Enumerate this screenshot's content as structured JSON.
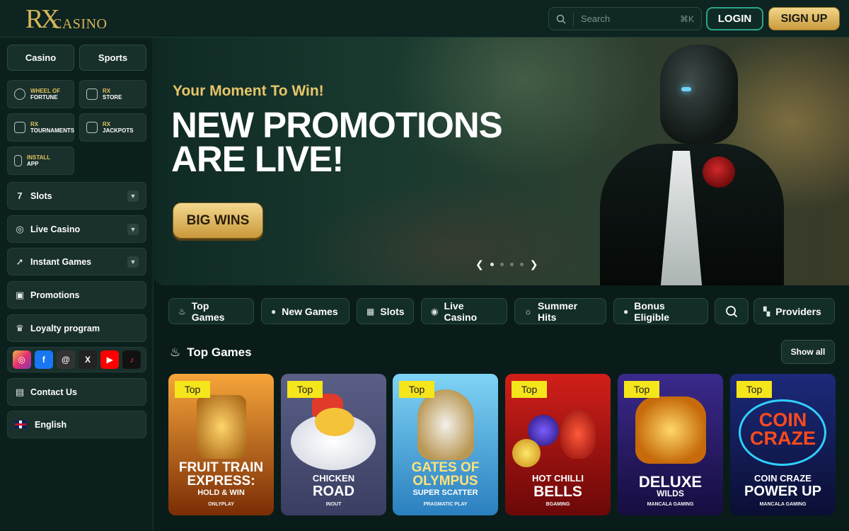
{
  "header": {
    "logo_mark": "RX",
    "logo_word": "CASINO",
    "search_placeholder": "Search",
    "search_shortcut": "⌘K",
    "login_label": "LOGIN",
    "signup_label": "SIGN UP"
  },
  "sidebar": {
    "tabs": [
      "Casino",
      "Sports"
    ],
    "tiles": [
      {
        "line1": "WHEEL OF",
        "line2": "FORTUNE",
        "icon": "wheel-icon"
      },
      {
        "line1": "RX",
        "line2": "STORE",
        "icon": "store-icon"
      },
      {
        "line1": "RX",
        "line2": "TOURNAMENTS",
        "icon": "trophy-icon"
      },
      {
        "line1": "RX",
        "line2": "JACKPOTS",
        "icon": "jackpot-icon"
      },
      {
        "line1": "INSTALL",
        "line2": "APP",
        "icon": "phone-icon"
      }
    ],
    "nav": [
      {
        "label": "Slots",
        "icon": "seven-icon",
        "expandable": true
      },
      {
        "label": "Live Casino",
        "icon": "chip-icon",
        "expandable": true
      },
      {
        "label": "Instant Games",
        "icon": "rocket-icon",
        "expandable": true
      },
      {
        "label": "Promotions",
        "icon": "gift-icon",
        "expandable": false
      },
      {
        "label": "Loyalty program",
        "icon": "crown-icon",
        "expandable": false
      }
    ],
    "socials": [
      {
        "name": "instagram-icon",
        "glyph": "◎"
      },
      {
        "name": "facebook-icon",
        "glyph": "f"
      },
      {
        "name": "threads-icon",
        "glyph": "@"
      },
      {
        "name": "x-icon",
        "glyph": "X"
      },
      {
        "name": "youtube-icon",
        "glyph": "▶"
      },
      {
        "name": "tiktok-icon",
        "glyph": "♪"
      }
    ],
    "contact_label": "Contact Us",
    "language_label": "English"
  },
  "hero": {
    "subtitle": "Your Moment To Win!",
    "title_line1": "NEW PROMOTIONS",
    "title_line2": "ARE LIVE!",
    "cta_label": "BIG WINS",
    "slides_total": 4,
    "active_slide": 1
  },
  "filters": [
    {
      "label": "Top Games",
      "icon": "fire-icon",
      "glyph": "♨"
    },
    {
      "label": "New Games",
      "icon": "new-icon",
      "glyph": "●"
    },
    {
      "label": "Slots",
      "icon": "slot-icon",
      "glyph": "▦"
    },
    {
      "label": "Live Casino",
      "icon": "chip-icon",
      "glyph": "◉"
    },
    {
      "label": "Summer Hits",
      "icon": "sun-icon",
      "glyph": "☼"
    },
    {
      "label": "Bonus Eligible",
      "icon": "bonus-icon",
      "glyph": "●"
    },
    {
      "label": "Providers",
      "icon": "grid-icon",
      "glyph": "▚"
    }
  ],
  "top_games": {
    "title": "Top Games",
    "show_all_label": "Show all",
    "badge": "Top",
    "games": [
      {
        "line1": "FRUIT TRAIN",
        "line2": "EXPRESS:",
        "line3": "HOLD & WIN",
        "provider": "ONLYPLAY",
        "bg1": "#f6a53a",
        "bg2": "#7a2d05"
      },
      {
        "line1": "CHICKEN",
        "line2": "ROAD",
        "line3": "",
        "provider": "INOUT",
        "bg1": "#5a5f86",
        "bg2": "#3a3e62"
      },
      {
        "line1": "GATES OF",
        "line2": "OLYMPUS",
        "line3": "SUPER SCATTER",
        "provider": "PRAGMATIC PLAY",
        "bg1": "#7fd4f5",
        "bg2": "#2a7fbf"
      },
      {
        "line1": "HOT CHILLI",
        "line2": "BELLS",
        "line3": "",
        "provider": "BGAMING",
        "bg1": "#d21f1a",
        "bg2": "#6a0808"
      },
      {
        "line1": "DELUXE",
        "line2": "WILDS",
        "line3": "",
        "provider": "MANCALA GAMING",
        "bg1": "#3b2a8c",
        "bg2": "#160d3f"
      },
      {
        "line1": "COIN CRAZE",
        "line2": "POWER UP",
        "line3": "",
        "provider": "MANCALA GAMING",
        "bg1": "#1c2a7a",
        "bg2": "#0a0f33"
      }
    ]
  }
}
